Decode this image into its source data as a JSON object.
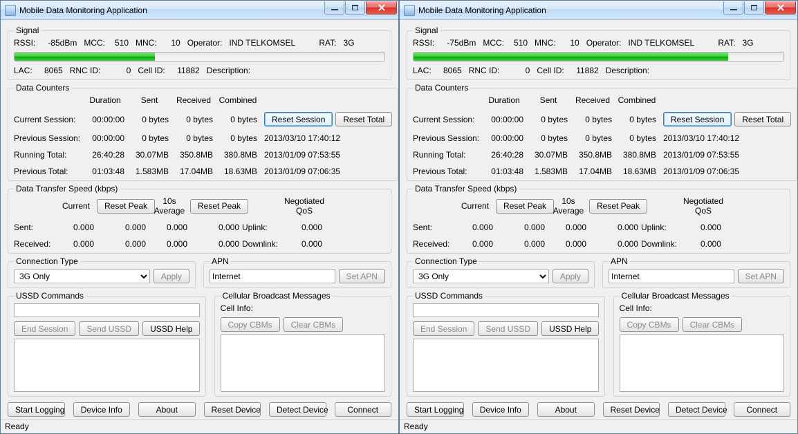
{
  "title": "Mobile Data Monitoring Application",
  "windows": [
    {
      "signal": {
        "rssi": "-85dBm",
        "mcc": "510",
        "mnc": "10",
        "operator": "IND TELKOMSEL",
        "rat": "3G",
        "lac": "8065",
        "rncid": "0",
        "cellid": "11882",
        "description": "",
        "progress_pct": 38
      }
    },
    {
      "signal": {
        "rssi": "-75dBm",
        "mcc": "510",
        "mnc": "10",
        "operator": "IND TELKOMSEL",
        "rat": "3G",
        "lac": "8065",
        "rncid": "0",
        "cellid": "11882",
        "description": "",
        "progress_pct": 85
      }
    }
  ],
  "labels": {
    "signal": "Signal",
    "rssi": "RSSI:",
    "mcc": "MCC:",
    "mnc": "MNC:",
    "operator": "Operator:",
    "rat": "RAT:",
    "lac": "LAC:",
    "rncid": "RNC ID:",
    "cellid": "Cell ID:",
    "description": "Description:",
    "data_counters": "Data Counters",
    "duration": "Duration",
    "sent": "Sent",
    "received": "Received",
    "combined": "Combined",
    "current_session": "Current Session:",
    "previous_session": "Previous Session:",
    "running_total": "Running Total:",
    "previous_total": "Previous Total:",
    "reset_session": "Reset Session",
    "reset_total": "Reset Total",
    "speed": "Data Transfer Speed (kbps)",
    "current": "Current",
    "reset_peak": "Reset Peak",
    "avg10": "10s Average",
    "sent_row": "Sent:",
    "recv_row": "Received:",
    "neg_qos": "Negotiated QoS",
    "uplink": "Uplink:",
    "downlink": "Downlink:",
    "conn_type": "Connection Type",
    "apply": "Apply",
    "apn": "APN",
    "set_apn": "Set APN",
    "ussd": "USSD Commands",
    "end_session": "End Session",
    "send_ussd": "Send USSD",
    "ussd_help": "USSD Help",
    "cbm": "Cellular Broadcast Messages",
    "cell_info": "Cell Info:",
    "copy_cbms": "Copy CBMs",
    "clear_cbms": "Clear CBMs",
    "start_logging": "Start Logging",
    "device_info": "Device Info",
    "about": "About",
    "reset_device": "Reset Device",
    "detect_device": "Detect Device",
    "connect": "Connect",
    "ready": "Ready"
  },
  "counters": {
    "current": {
      "duration": "00:00:00",
      "sent": "0 bytes",
      "received": "0 bytes",
      "combined": "0 bytes",
      "ts": ""
    },
    "previous": {
      "duration": "00:00:00",
      "sent": "0 bytes",
      "received": "0 bytes",
      "combined": "0 bytes",
      "ts": "2013/03/10 17:40:12"
    },
    "running": {
      "duration": "26:40:28",
      "sent": "30.07MB",
      "received": "350.8MB",
      "combined": "380.8MB",
      "ts": "2013/01/09 07:53:55"
    },
    "prevtot": {
      "duration": "01:03:48",
      "sent": "1.583MB",
      "received": "17.04MB",
      "combined": "18.63MB",
      "ts": "2013/01/09 07:06:35"
    }
  },
  "speed": {
    "sent": {
      "c1": "0.000",
      "p1": "0.000",
      "c2": "0.000",
      "p2": "0.000"
    },
    "received": {
      "c1": "0.000",
      "p1": "0.000",
      "c2": "0.000",
      "p2": "0.000"
    },
    "uplink": "0.000",
    "downlink": "0.000"
  },
  "conn_type_value": "3G Only",
  "apn_value": "Internet"
}
